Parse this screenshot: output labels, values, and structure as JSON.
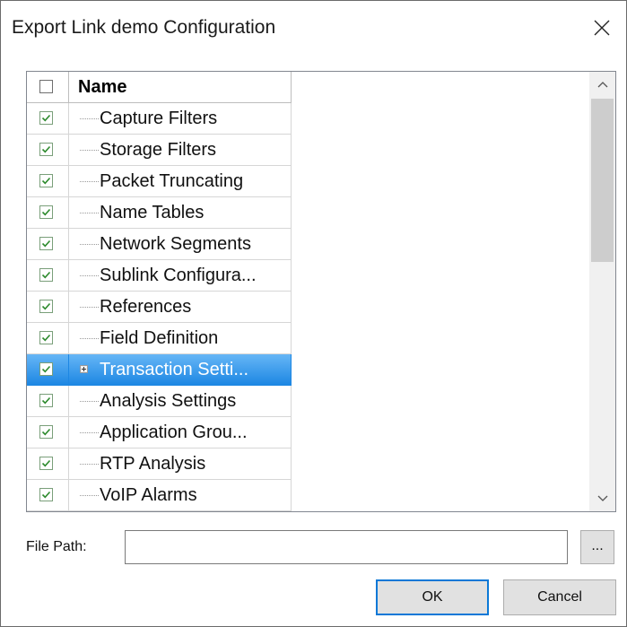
{
  "window": {
    "title": "Export Link demo Configuration"
  },
  "tree": {
    "header": {
      "name": "Name",
      "checked": false
    },
    "items": [
      {
        "label": "Capture Filters",
        "checked": true
      },
      {
        "label": "Storage Filters",
        "checked": true
      },
      {
        "label": "Packet Truncating",
        "checked": true
      },
      {
        "label": "Name Tables",
        "checked": true
      },
      {
        "label": "Network Segments",
        "checked": true
      },
      {
        "label": "Sublink Configura...",
        "checked": true
      },
      {
        "label": "References",
        "checked": true
      },
      {
        "label": "Field Definition",
        "checked": true
      },
      {
        "label": "Transaction Setti...",
        "checked": true,
        "selected": true,
        "expandable": true
      },
      {
        "label": "Analysis Settings",
        "checked": true
      },
      {
        "label": "Application Grou...",
        "checked": true
      },
      {
        "label": "RTP Analysis",
        "checked": true
      },
      {
        "label": "VoIP Alarms",
        "checked": true
      }
    ]
  },
  "file_path": {
    "label": "File Path:",
    "value": "",
    "browse_label": "..."
  },
  "buttons": {
    "ok": "OK",
    "cancel": "Cancel"
  },
  "colors": {
    "selection_top": "#66b6f6",
    "selection_bottom": "#1d87e3",
    "check_mark": "#2e8b2e",
    "ok_border": "#0a78d7"
  }
}
